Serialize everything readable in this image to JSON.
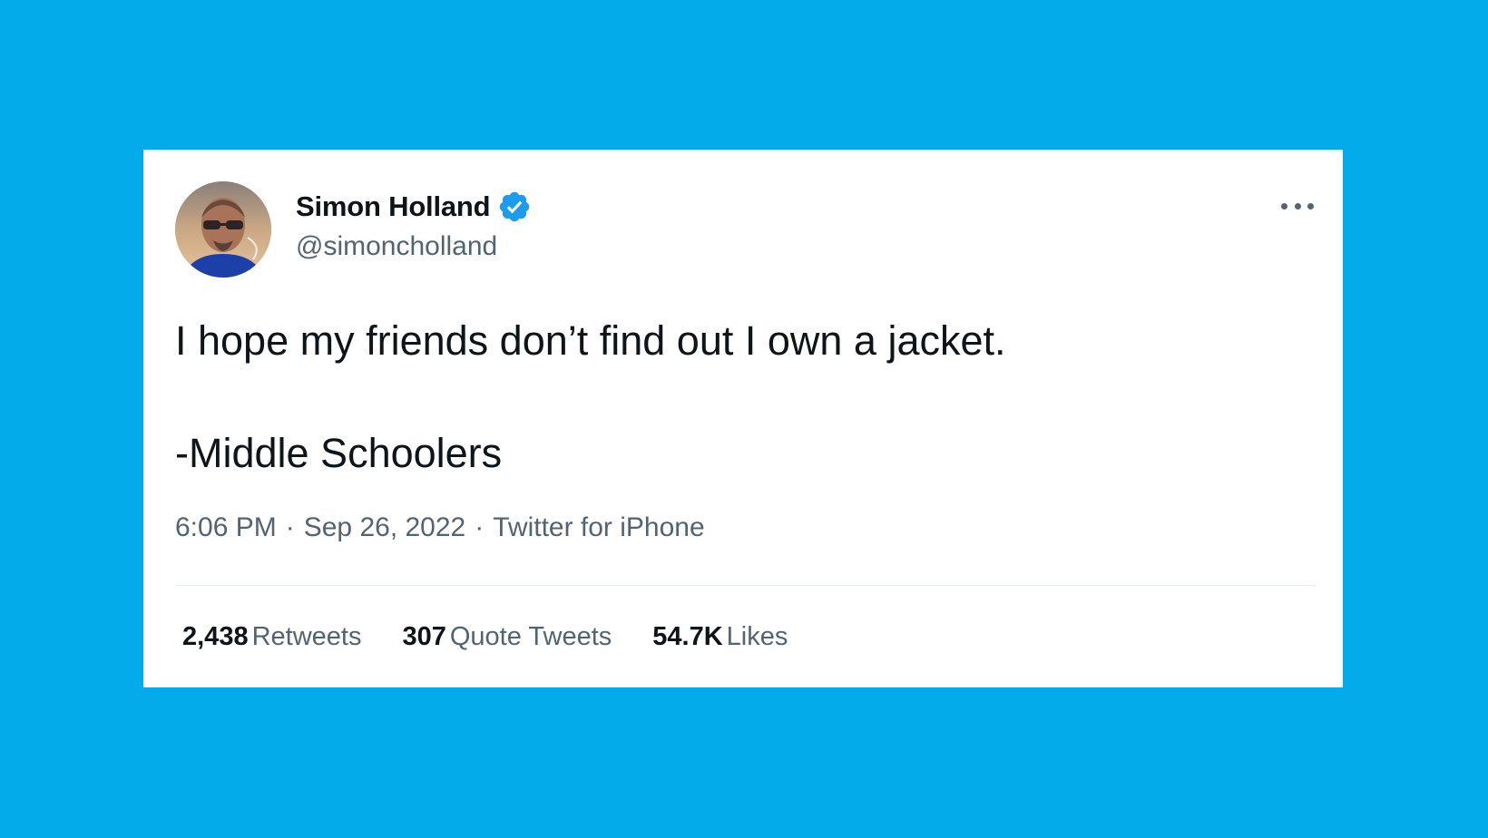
{
  "colors": {
    "background": "#04abea",
    "card": "#ffffff",
    "primary_text": "#0f1419",
    "secondary_text": "#536471",
    "verified_badge": "#1d9bf0"
  },
  "tweet": {
    "author": {
      "display_name": "Simon Holland",
      "handle": "@simoncholland",
      "verified": true,
      "verified_icon": "verified-badge-icon",
      "avatar_icon": "user-avatar"
    },
    "text_lines": [
      "I hope my friends don’t find out I own a jacket.",
      "-Middle Schoolers"
    ],
    "time": "6:06 PM",
    "date": "Sep 26, 2022",
    "source": "Twitter for iPhone",
    "separator": "·",
    "more_icon": "more-horizontal-icon",
    "stats": [
      {
        "count": "2,438",
        "label": "Retweets"
      },
      {
        "count": "307",
        "label": "Quote Tweets"
      },
      {
        "count": "54.7K",
        "label": "Likes"
      }
    ]
  }
}
